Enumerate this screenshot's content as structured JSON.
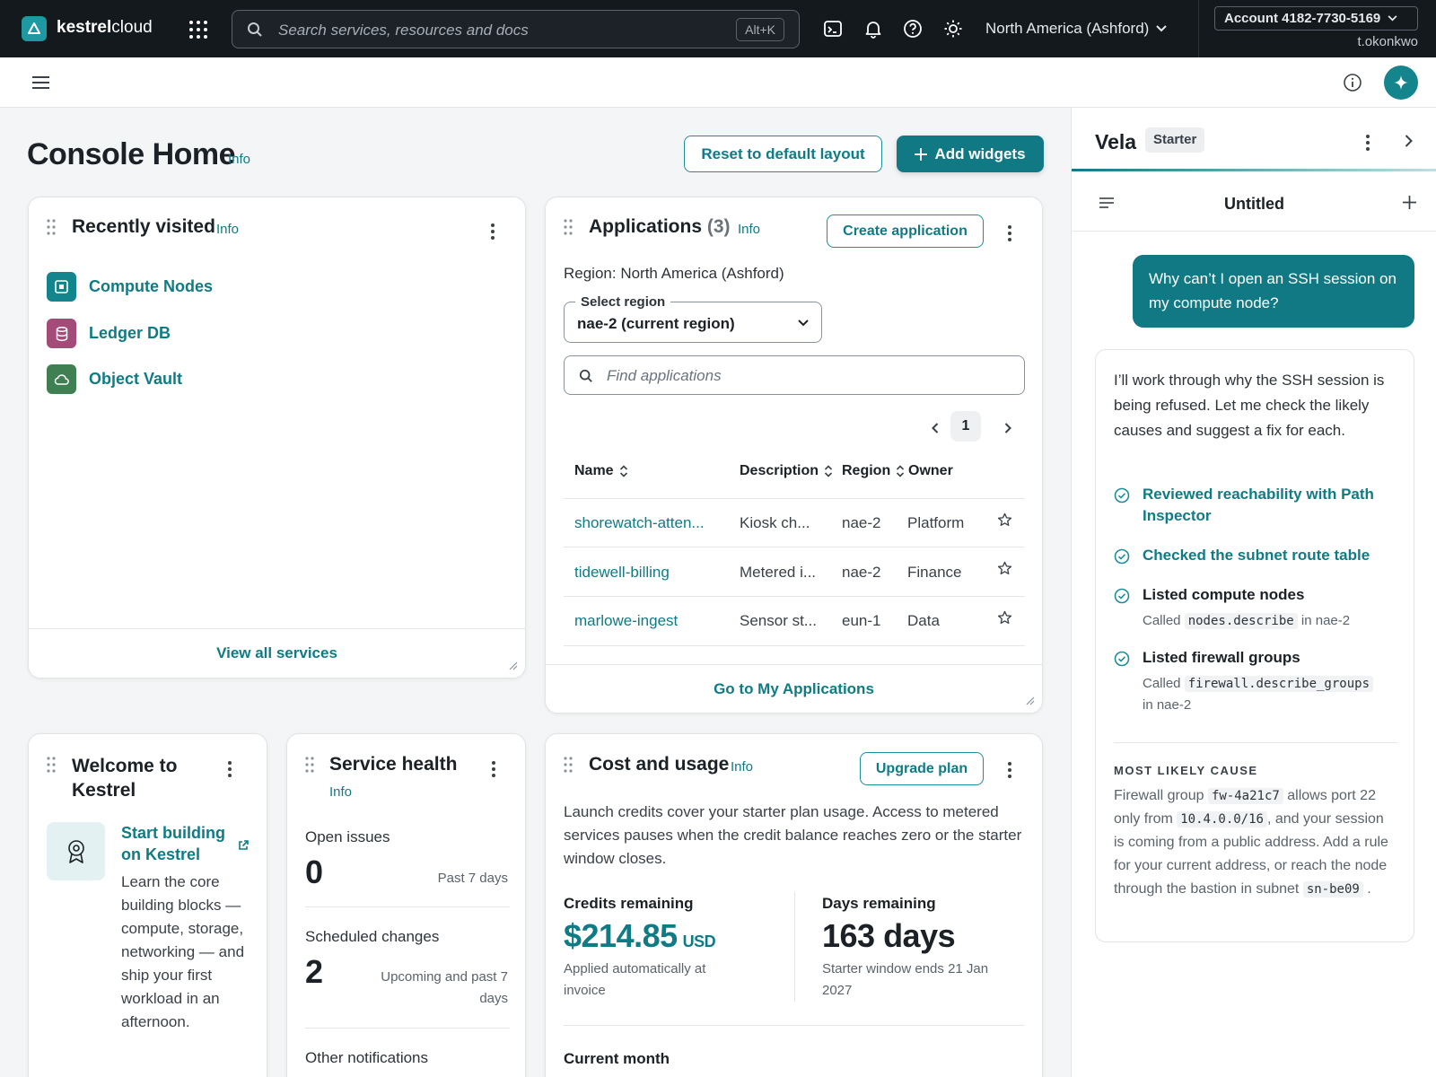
{
  "brand": {
    "name_bold": "kestrel",
    "name_rest": "cloud"
  },
  "topnav": {
    "search_placeholder": "Search services, resources and docs",
    "search_shortcut": "Alt+K",
    "region": "North America (Ashford)",
    "account": "Account 4182-7730-5169",
    "user": "t.okonkwo"
  },
  "page": {
    "title": "Console Home",
    "info": "Info",
    "reset_button": "Reset to default layout",
    "add_widgets_button": "Add widgets"
  },
  "recently_visited": {
    "title": "Recently visited",
    "info": "Info",
    "items": [
      {
        "label": "Compute Nodes",
        "icon": "compute-icon",
        "color": "#14848d"
      },
      {
        "label": "Ledger DB",
        "icon": "database-icon",
        "color": "#a44b7a"
      },
      {
        "label": "Object Vault",
        "icon": "cloud-storage-icon",
        "color": "#3f7f52"
      }
    ],
    "footer_link": "View all services"
  },
  "applications": {
    "title": "Applications",
    "count": "(3)",
    "info": "Info",
    "create_button": "Create application",
    "region_text": "Region: North America (Ashford)",
    "select_label": "Select region",
    "select_value": "nae-2 (current region)",
    "find_placeholder": "Find applications",
    "page": "1",
    "columns": [
      "Name",
      "Description",
      "Region",
      "Owner"
    ],
    "rows": [
      {
        "name": "shorewatch-atten...",
        "description": "Kiosk ch...",
        "region": "nae-2",
        "owner": "Platform"
      },
      {
        "name": "tidewell-billing",
        "description": "Metered i...",
        "region": "nae-2",
        "owner": "Finance"
      },
      {
        "name": "marlowe-ingest",
        "description": "Sensor st...",
        "region": "eun-1",
        "owner": "Data"
      }
    ],
    "footer_link": "Go to My Applications"
  },
  "welcome": {
    "title_line1": "Welcome to",
    "title_line2": "Kestrel",
    "link_line1": "Start building",
    "link_line2": "on Kestrel",
    "body": "Learn the core building blocks — compute, storage, networking — and ship your first workload in an afternoon."
  },
  "service_health": {
    "title": "Service health",
    "info": "Info",
    "open_issues_label": "Open issues",
    "open_issues_value": "0",
    "open_issues_period": "Past 7 days",
    "scheduled_label": "Scheduled changes",
    "scheduled_value": "2",
    "scheduled_period": "Upcoming and past 7 days",
    "other_label": "Other notifications"
  },
  "cost_usage": {
    "title": "Cost and usage",
    "info": "Info",
    "upgrade_button": "Upgrade plan",
    "body": "Launch credits cover your starter plan usage. Access to metered services pauses when the credit balance reaches zero or the starter window closes.",
    "credits_label": "Credits remaining",
    "credits_value": "$214.85",
    "credits_unit": "USD",
    "credits_note": "Applied automatically at invoice",
    "days_label": "Days remaining",
    "days_value": "163 days",
    "days_note": "Starter window ends 21 Jan 2027",
    "current_month_label": "Current month"
  },
  "vela": {
    "title": "Vela",
    "badge": "Starter",
    "chat_title": "Untitled",
    "user_message": "Why can’t I open an SSH session on my compute node?",
    "intro": "I’ll work through why the SSH session is being refused. Let me check the likely causes and suggest a fix for each.",
    "steps": [
      {
        "title": "Reviewed reachability with Path Inspector",
        "link": true
      },
      {
        "title": "Checked the subnet route table",
        "link": true
      },
      {
        "title": "Listed compute nodes",
        "link": false,
        "pre": "Called",
        "code": "nodes.describe",
        "post": "in nae-2"
      },
      {
        "title": "Listed firewall groups",
        "link": false,
        "pre": "Called",
        "code": "firewall.describe_groups",
        "post": "in nae-2"
      }
    ],
    "cause_heading": "MOST LIKELY CAUSE",
    "cause": {
      "t1": "Firewall group",
      "c1": "fw-4a21c7",
      "t2": "allows port 22 only from",
      "c2": "10.4.0.0/16",
      "t3": ", and your session is coming from a public address. Add a rule for your current address, or reach the node through the bastion in subnet",
      "c3": "sn-be09",
      "t4": "."
    }
  },
  "colors": {
    "accent": "#117983",
    "link": "#0f7b84",
    "nav_bg": "#14191e"
  }
}
